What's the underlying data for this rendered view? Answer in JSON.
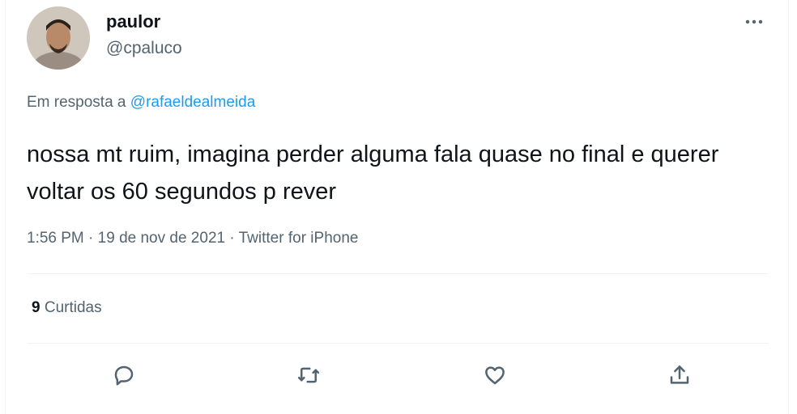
{
  "user": {
    "display_name": "paulor",
    "handle": "@cpaluco"
  },
  "reply": {
    "prefix": "Em resposta a",
    "mention": "@rafaeldealmeida"
  },
  "tweet": {
    "text": "nossa mt ruim, imagina perder alguma fala quase no final e querer voltar os 60 segundos p rever"
  },
  "meta": {
    "time": "1:56 PM",
    "separator": "·",
    "date": "19 de nov de 2021",
    "source": "Twitter for iPhone"
  },
  "stats": {
    "likes_count": "9",
    "likes_label": "Curtidas"
  },
  "colors": {
    "text": "#0f1419",
    "secondary": "#536471",
    "link": "#1d9bf0",
    "divider": "#eff3f4"
  },
  "icons": {
    "more": "more-dots-icon",
    "reply": "reply-icon",
    "retweet": "retweet-icon",
    "like": "heart-icon",
    "share": "share-icon"
  }
}
